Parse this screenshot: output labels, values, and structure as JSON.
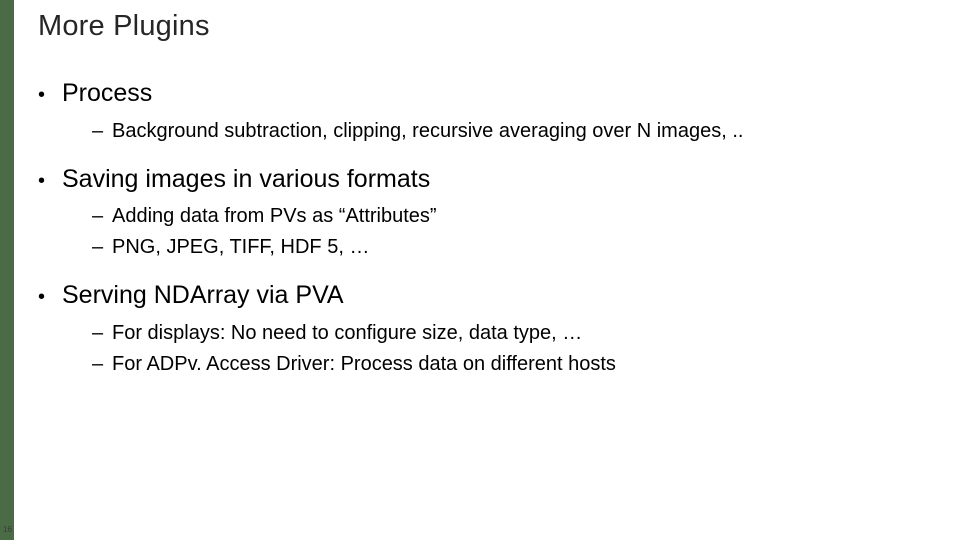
{
  "title": "More Plugins",
  "bullets": [
    {
      "text": "Process",
      "subs": [
        "Background subtraction, clipping, recursive averaging over N images, .."
      ]
    },
    {
      "text": "Saving images in various formats",
      "subs": [
        "Adding data from PVs as “Attributes”",
        "PNG, JPEG, TIFF, HDF 5, …"
      ]
    },
    {
      "text": "Serving NDArray via PVA",
      "subs": [
        "For displays: No need to configure size, data type, …",
        "For ADPv. Access Driver: Process data on different hosts"
      ]
    }
  ],
  "page_number": "16"
}
